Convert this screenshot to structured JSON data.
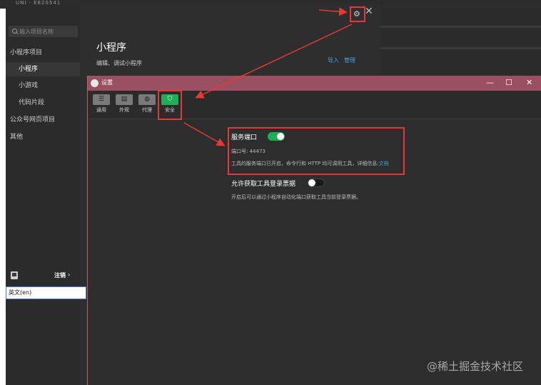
{
  "background": {
    "strip_text": "UNI · E820541"
  },
  "ide": {
    "search_placeholder": "输入项目名称",
    "nav": [
      {
        "label": "小程序项目",
        "level": 1,
        "active": false
      },
      {
        "label": "小程序",
        "level": 2,
        "active": true
      },
      {
        "label": "小游戏",
        "level": 2,
        "active": false
      },
      {
        "label": "代码片段",
        "level": 2,
        "active": false
      },
      {
        "label": "公众号网页项目",
        "level": 1,
        "active": false
      },
      {
        "label": "其他",
        "level": 1,
        "active": false
      }
    ],
    "logout_label": "注销",
    "logout_chevron": "›",
    "ime_text": "英文(en)",
    "title": "小程序",
    "subtitle": "编辑、调试小程序",
    "import_link": "导入",
    "manage_link": "管理",
    "close_glyph": "✕",
    "gear_glyph": "⚙"
  },
  "settings": {
    "title": "设置",
    "controls": {
      "minimize": "—",
      "maximize": "☐",
      "close": "✕"
    },
    "tabs": [
      {
        "label": "通用",
        "icon": "list-icon",
        "glyph": "☰",
        "active": false
      },
      {
        "label": "外观",
        "icon": "layout-icon",
        "glyph": "▤",
        "active": false
      },
      {
        "label": "代理",
        "icon": "globe-icon",
        "glyph": "◍",
        "active": false
      },
      {
        "label": "安全",
        "icon": "shield-icon",
        "glyph": "⛉",
        "active": true
      }
    ],
    "service_port": {
      "title": "服务端口",
      "enabled": true,
      "port_line": "端口号: 44473",
      "desc": "工具的服务端口已开启，命令行和 HTTP 均可调用工具，详细信息:",
      "doc_link": "文档"
    },
    "login_ticket": {
      "title": "允许获取工具登录票据",
      "enabled": false,
      "desc": "开启后可以通过小程序自动化端口获取工具当前登录票据。"
    }
  },
  "watermark": "@稀土掘金技术社区",
  "colors": {
    "accent_green": "#1fae54",
    "annotation_red": "#e53935",
    "link_blue": "#3fa5e5",
    "titlebar": "#9a5060"
  }
}
